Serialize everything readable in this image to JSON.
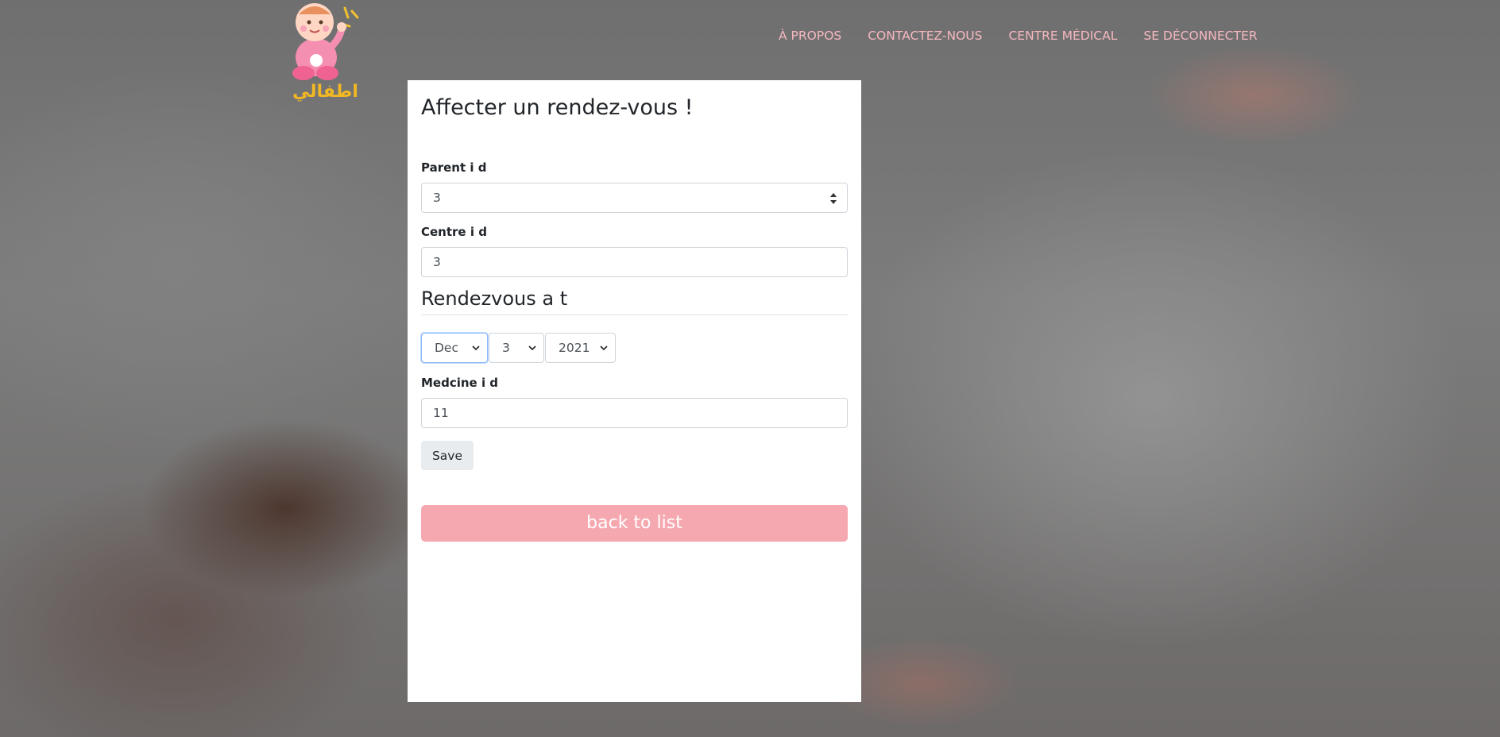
{
  "nav": {
    "items": [
      {
        "label": "À PROPOS"
      },
      {
        "label": "CONTACTEZ-NOUS"
      },
      {
        "label": "CENTRE MÉDICAL"
      },
      {
        "label": "SE DÉCONNECTER"
      }
    ]
  },
  "logo": {
    "icon": "baby-logo-icon",
    "text": "اطفالي"
  },
  "form": {
    "title": "Affecter un rendez-vous !",
    "parent_label": "Parent i d",
    "parent_value": "3",
    "centre_label": "Centre i d",
    "centre_value": "3",
    "section_title": "Rendezvous a t",
    "month_value": "Dec",
    "day_value": "3",
    "year_value": "2021",
    "medecine_label": "Medcine i d",
    "medecine_value": "11",
    "save_label": "Save",
    "back_label": "back to list"
  },
  "colors": {
    "nav_text": "#f6b7bf",
    "accent_pink": "#f6a8b0",
    "focus_blue": "#86b7fe"
  }
}
